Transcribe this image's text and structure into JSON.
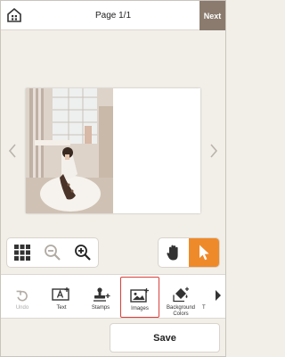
{
  "header": {
    "home_icon": "home-icon",
    "page_title": "Page 1/1",
    "next_label": "Next",
    "next_color": "#8a7b6e"
  },
  "canvas": {
    "prev_icon": "chevron-left-icon",
    "next_icon": "chevron-right-icon"
  },
  "zoom_controls": {
    "layout_icon": "grid-icon",
    "zoom_out_icon": "zoom-out-icon",
    "zoom_in_icon": "zoom-in-icon"
  },
  "mode_controls": {
    "hand_icon": "hand-icon",
    "pointer_icon": "pointer-icon",
    "active_color": "#ef8a2a"
  },
  "toolbar": {
    "items": [
      {
        "label": "Undo",
        "icon": "undo-icon",
        "enabled": false
      },
      {
        "label": "Text",
        "icon": "text-add-icon",
        "enabled": true
      },
      {
        "label": "Stamps",
        "icon": "stamp-add-icon",
        "enabled": true
      },
      {
        "label": "Images",
        "icon": "image-add-icon",
        "enabled": true,
        "selected": true
      },
      {
        "label": "Background\nColors",
        "icon": "paint-bucket-icon",
        "enabled": true
      },
      {
        "label": "T",
        "icon": "truncated-tool-icon",
        "enabled": true
      }
    ],
    "more_icon": "chevron-right-icon",
    "selected_border_color": "#d8403a"
  },
  "save_label": "Save"
}
